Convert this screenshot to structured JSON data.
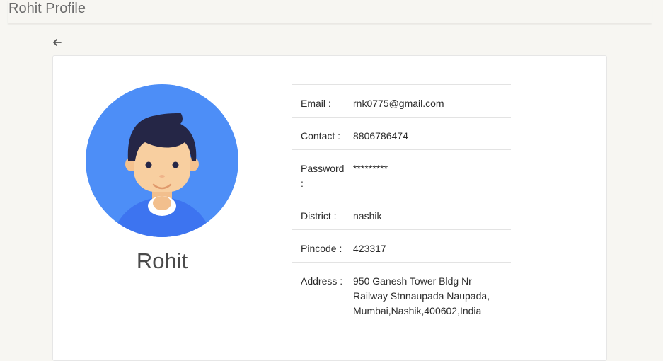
{
  "header": {
    "title": "Rohit Profile"
  },
  "profile": {
    "name": "Rohit",
    "avatar_icon": "user-avatar-icon",
    "back_icon": "arrow-left-icon"
  },
  "details": {
    "email_label": "Email :",
    "email_value": "rnk0775@gmail.com",
    "contact_label": "Contact :",
    "contact_value": "8806786474",
    "password_label": "Password :",
    "password_value": "*********",
    "district_label": "District :",
    "district_value": "nashik",
    "pincode_label": "Pincode :",
    "pincode_value": "423317",
    "address_label": "Address :",
    "address_value": "950 Ganesh Tower Bldg Nr Railway Stnnaupada Naupada, Mumbai,Nashik,400602,India"
  },
  "colors": {
    "header_border": "#c9bf7a",
    "avatar_bg": "#4d8ef7",
    "avatar_shirt": "#3d74f0",
    "hair": "#2a2a4a",
    "skin": "#f8cfa0"
  }
}
